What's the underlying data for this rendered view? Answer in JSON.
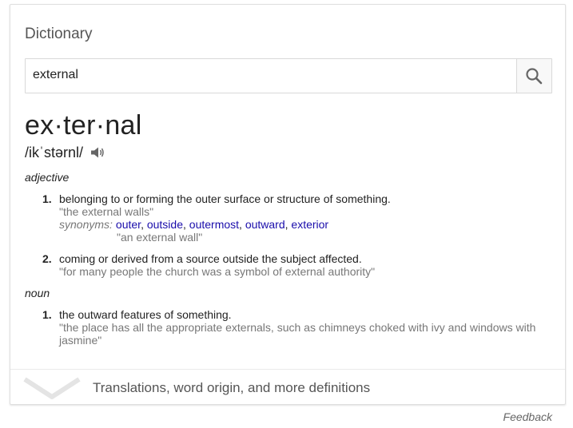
{
  "card": {
    "title": "Dictionary",
    "search": {
      "value": "external",
      "icon": "search-icon"
    },
    "headword": "ex·ter·nal",
    "pronunciation": "/ikˈstərnl/",
    "sections": [
      {
        "pos": "adjective",
        "definitions": [
          {
            "number": "1.",
            "text": "belonging to or forming the outer surface or structure of something.",
            "example": "\"the external walls\"",
            "synonyms_label": "synonyms:",
            "synonyms": [
              "outer",
              "outside",
              "outermost",
              "outward",
              "exterior"
            ],
            "synonym_example": "\"an external wall\""
          },
          {
            "number": "2.",
            "text": "coming or derived from a source outside the subject affected.",
            "example": "\"for many people the church was a symbol of external authority\""
          }
        ]
      },
      {
        "pos": "noun",
        "definitions": [
          {
            "number": "1.",
            "text": "the outward features of something.",
            "example": "\"the place has all the appropriate externals, such as chimneys choked with ivy and windows with jasmine\""
          }
        ]
      }
    ],
    "footer": {
      "label": "Translations, word origin, and more definitions",
      "icon": "chevron-down-icon"
    }
  },
  "feedback": "Feedback",
  "colors": {
    "link": "#1a0dab",
    "example": "#777777",
    "text": "#222222"
  }
}
